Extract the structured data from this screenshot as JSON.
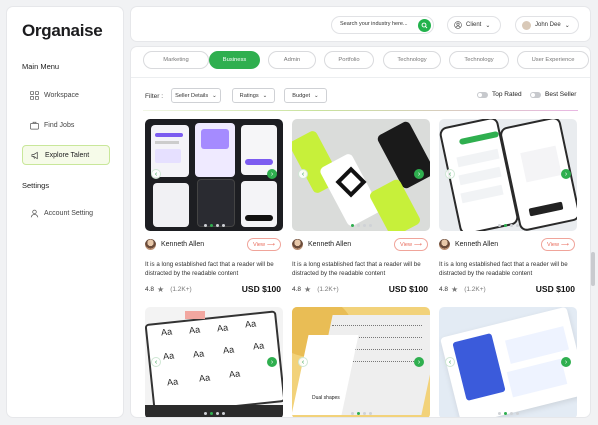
{
  "brand": "Organaise",
  "sidebar": {
    "main_menu_heading": "Main Menu",
    "items": [
      {
        "label": "Workspace",
        "icon": "grid-icon"
      },
      {
        "label": "Find Jobs",
        "icon": "briefcase-icon"
      },
      {
        "label": "Explore Talent",
        "icon": "megaphone-icon",
        "active": true
      }
    ],
    "settings_heading": "Settings",
    "settings_items": [
      {
        "label": "Account Setting",
        "icon": "user-icon"
      }
    ]
  },
  "topbar": {
    "search_placeholder": "Search your industry here...",
    "client_label": "Client",
    "user_name": "John Dee"
  },
  "tabs": [
    "Marketing",
    "Business",
    "Admin",
    "Portfolio",
    "Technology",
    "Technology",
    "User Experience"
  ],
  "active_tab": "Business",
  "filters": {
    "label": "Filter :",
    "dropdowns": [
      "Seller Details",
      "Ratings",
      "Budget"
    ],
    "toggles": [
      "Top Rated",
      "Best Seller"
    ]
  },
  "cards": [
    {
      "author": "Kenneth Allen",
      "view": "View",
      "desc": "It is a long established fact that a reader will be distracted by the readable content",
      "rating": "4.8",
      "count": "(1.2K+)",
      "price": "USD $100"
    },
    {
      "author": "Kenneth Allen",
      "view": "View",
      "desc": "It is a long established fact that a reader will be distracted by the readable content",
      "rating": "4.8",
      "count": "(1.2K+)",
      "price": "USD $100"
    },
    {
      "author": "Kenneth Allen",
      "view": "View",
      "desc": "It is a long established fact that a reader will be distracted by the readable content",
      "rating": "4.8",
      "count": "(1.2K+)",
      "price": "USD $100"
    }
  ],
  "thumb_texts": {
    "card4_letters": "Aa",
    "card5_title": "Dual shapes"
  },
  "colors": {
    "accent_green": "#2faf4f",
    "lime": "#c7f03a",
    "view_red": "#e86a5a"
  }
}
